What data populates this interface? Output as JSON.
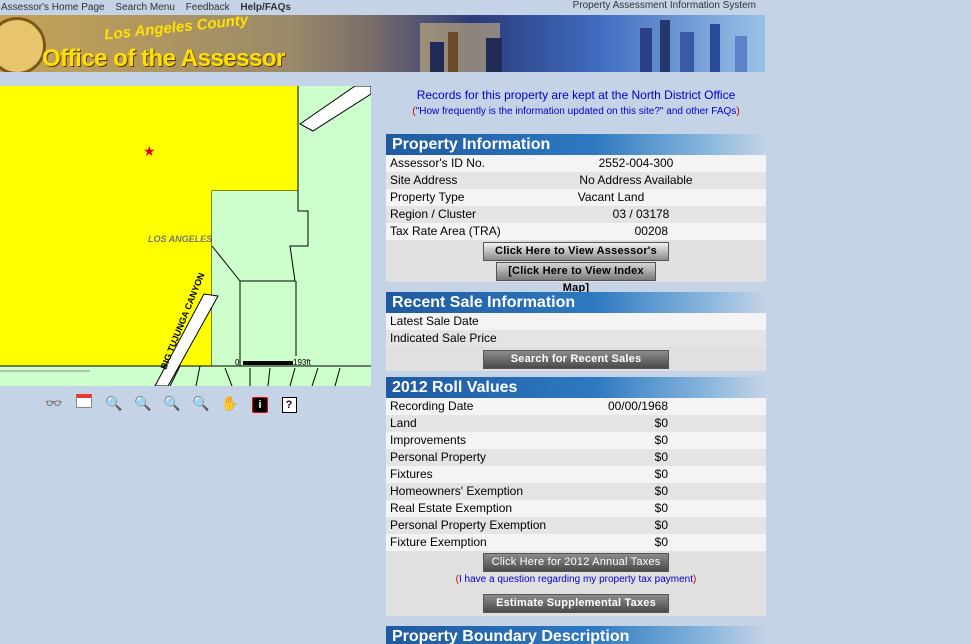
{
  "nav": {
    "home": "Assessor's Home Page",
    "search_menu": "Search Menu",
    "feedback": "Feedback",
    "help": "Help/FAQs",
    "system_title": "Property Assessment Information System"
  },
  "banner": {
    "county": "Los Angeles County",
    "office": "Office of the Assessor"
  },
  "map": {
    "area_label": "LOS ANGELES",
    "street_label": "BIG TUJUNGA CANYON",
    "scale_start": "0",
    "scale_end": "193ft"
  },
  "header": {
    "records_link": "Records for this property are kept at the North District Office",
    "faq_open": "(",
    "faq_link": "\"How frequently is the information updated on this site?\" and other FAQs",
    "faq_close": ")"
  },
  "property_info": {
    "title": "Property Information",
    "rows": [
      {
        "label": "Assessor's ID No.",
        "value": "2552-004-300"
      },
      {
        "label": "Site Address",
        "value": "No Address Available"
      },
      {
        "label": "Property Type",
        "value": "Vacant Land"
      },
      {
        "label": "Region / Cluster",
        "value": "03 / 03178"
      },
      {
        "label": "Tax Rate Area (TRA)",
        "value": "00208"
      }
    ],
    "map_button": "Click Here to View Assessor's Map",
    "index_button": "[Click Here to View Index Map]"
  },
  "recent_sale": {
    "title": "Recent Sale Information",
    "rows": [
      {
        "label": "Latest Sale Date",
        "value": ""
      },
      {
        "label": "Indicated Sale Price",
        "value": ""
      }
    ],
    "search_button": "Search for Recent Sales"
  },
  "roll_values": {
    "title": "2012 Roll Values",
    "rows": [
      {
        "label": "Recording Date",
        "value": "00/00/1968"
      },
      {
        "label": "Land",
        "value": "$0"
      },
      {
        "label": "Improvements",
        "value": "$0"
      },
      {
        "label": "Personal Property",
        "value": "$0"
      },
      {
        "label": "Fixtures",
        "value": "$0"
      },
      {
        "label": "Homeowners' Exemption",
        "value": "$0"
      },
      {
        "label": "Real Estate Exemption",
        "value": "$0"
      },
      {
        "label": "Personal Property Exemption",
        "value": "$0"
      },
      {
        "label": "Fixture Exemption",
        "value": "$0"
      }
    ],
    "taxes_button": "Click Here for 2012 Annual Taxes",
    "question_open": "(",
    "question_link": "I have a question regarding my property tax payment",
    "question_close": ")",
    "supplemental_button": "Estimate Supplemental Taxes"
  },
  "boundary": {
    "title": "Property Boundary Description"
  },
  "colors": {
    "parcel_fill": "#ffff00",
    "map_background": "#ccffcc",
    "page_background": "#c5d3e6",
    "header_blue": "#1f5aa0"
  }
}
